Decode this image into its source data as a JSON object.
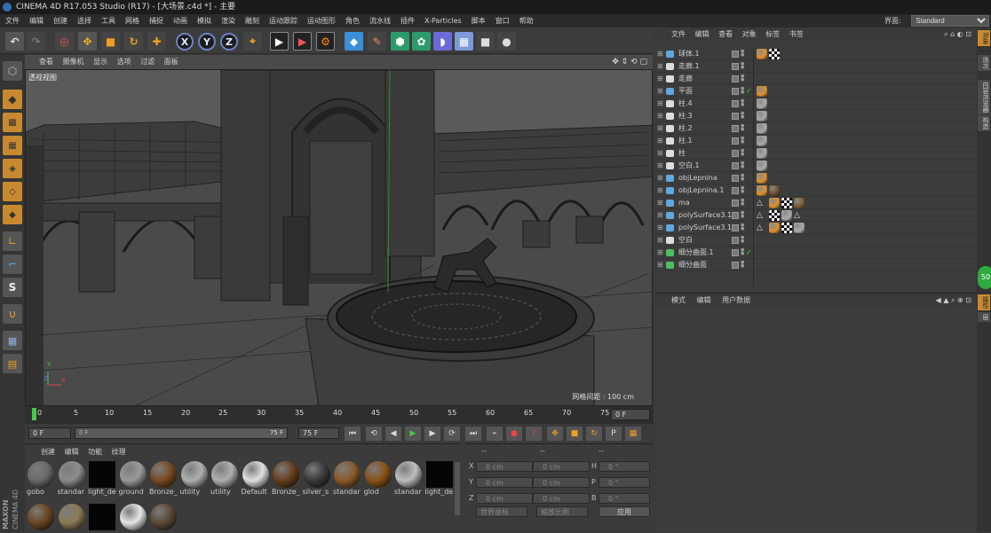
{
  "titlebar": {
    "title": "CINEMA 4D R17.053 Studio (R17) - [大场景.c4d *] - 主要"
  },
  "menubar": {
    "items": [
      "文件",
      "编辑",
      "创建",
      "选择",
      "工具",
      "网格",
      "捕捉",
      "动画",
      "模拟",
      "渲染",
      "雕刻",
      "运动跟踪",
      "运动图形",
      "角色",
      "流水线",
      "插件",
      "X-Particles",
      "脚本",
      "窗口",
      "帮助"
    ],
    "interface_label": "界面:",
    "interface_value": "Standard"
  },
  "viewport": {
    "menu": [
      "查看",
      "摄像机",
      "显示",
      "选项",
      "过滤",
      "面板"
    ],
    "view_name": "透视视图",
    "grid_label": "网格间距 : 100 cm",
    "axis_x": "X",
    "axis_y": "Y",
    "axis_z": "Z"
  },
  "timeline": {
    "ticks": [
      "0",
      "5",
      "10",
      "15",
      "20",
      "25",
      "30",
      "35",
      "40",
      "45",
      "50",
      "55",
      "60",
      "65",
      "70",
      "75"
    ],
    "current_frame": "0 F"
  },
  "transport": {
    "start_field": "0 F",
    "range_start": "0 F",
    "range_end": "75 F",
    "end_field": "75 F"
  },
  "materials": {
    "menu": [
      "创建",
      "编辑",
      "功能",
      "纹理"
    ],
    "items": [
      {
        "label": "gobo",
        "color": "#6a6a6a"
      },
      {
        "label": "standar",
        "color": "#8c8c8c"
      },
      {
        "label": "light_de",
        "color": "#050505"
      },
      {
        "label": "ground",
        "color": "#9a9a9a"
      },
      {
        "label": "Bronze_",
        "color": "#7a4a22"
      },
      {
        "label": "utility",
        "color": "#b0b0b0"
      },
      {
        "label": "utility",
        "color": "#b0b0b0"
      },
      {
        "label": "Default",
        "color": "#e0e0e0"
      },
      {
        "label": "Bronze_",
        "color": "#6a3f1c"
      },
      {
        "label": "silver_s",
        "color": "#3a3a3a"
      },
      {
        "label": "standar",
        "color": "#8a5a2a"
      },
      {
        "label": "glod",
        "color": "#8a5218"
      },
      {
        "label": "standar",
        "color": "#bdbdbd"
      },
      {
        "label": "light_de",
        "color": "#050505"
      }
    ],
    "row2": [
      {
        "color": "#6a4520"
      },
      {
        "color": "#8a7a55"
      },
      {
        "color": "#050505"
      },
      {
        "color": "#e6e6e6"
      },
      {
        "color": "#5a4a38"
      }
    ]
  },
  "coords": {
    "headers": [
      "--",
      "--",
      "--"
    ],
    "rows": [
      {
        "a": "X",
        "av": "0 cm",
        "b": "X",
        "bv": "0 cm",
        "c": "H",
        "cv": "0 °"
      },
      {
        "a": "Y",
        "av": "0 cm",
        "b": "Y",
        "bv": "0 cm",
        "c": "P",
        "cv": "0 °"
      },
      {
        "a": "Z",
        "av": "0 cm",
        "b": "Z",
        "bv": "0 cm",
        "c": "B",
        "cv": "0 °"
      }
    ],
    "space": "世界坐标",
    "scale": "缩放比例",
    "apply": "应用"
  },
  "objects": {
    "menu": [
      "文件",
      "编辑",
      "查看",
      "对象",
      "标签",
      "书签"
    ],
    "rows": [
      {
        "name": "球体.1",
        "icon": "#5fa8e0",
        "ok": false,
        "tags": [
          "#e0902a",
          "chk"
        ]
      },
      {
        "name": "走廊.1",
        "icon": "#ddd",
        "ok": false,
        "tags": []
      },
      {
        "name": "走廊",
        "icon": "#ddd",
        "ok": false,
        "tags": []
      },
      {
        "name": "平面",
        "icon": "#5fa8e0",
        "ok": true,
        "tags": [
          "#e0902a"
        ]
      },
      {
        "name": "柱.4",
        "icon": "#ddd",
        "ok": false,
        "tags": [
          "#aaa"
        ]
      },
      {
        "name": "柱.3",
        "icon": "#ddd",
        "ok": false,
        "tags": [
          "#aaa"
        ]
      },
      {
        "name": "柱.2",
        "icon": "#ddd",
        "ok": false,
        "tags": [
          "#aaa"
        ]
      },
      {
        "name": "柱.1",
        "icon": "#ddd",
        "ok": false,
        "tags": [
          "#aaa"
        ]
      },
      {
        "name": "柱",
        "icon": "#ddd",
        "ok": false,
        "tags": [
          "#aaa"
        ]
      },
      {
        "name": "空白.1",
        "icon": "#ddd",
        "ok": false,
        "tags": [
          "#aaa"
        ]
      },
      {
        "name": "objLepnina",
        "icon": "#5fa8e0",
        "ok": false,
        "tags": [
          "#e0902a"
        ]
      },
      {
        "name": "objLepnina.1",
        "icon": "#5fa8e0",
        "ok": false,
        "tags": [
          "#e0902a",
          "#6a4a2a"
        ]
      },
      {
        "name": "ma",
        "icon": "#5fa8e0",
        "ok": false,
        "tags": [
          "tri",
          "#e0902a",
          "chk",
          "#7a5a35"
        ]
      },
      {
        "name": "polySurface3.1",
        "icon": "#5fa8e0",
        "ok": false,
        "tags": [
          "tri",
          "chk",
          "#aaa",
          "tri"
        ]
      },
      {
        "name": "polySurface3.1",
        "icon": "#5fa8e0",
        "ok": false,
        "tags": [
          "tri",
          "#e0902a",
          "chk",
          "#aaa"
        ]
      },
      {
        "name": "空白",
        "icon": "#ddd",
        "ok": false,
        "tags": []
      },
      {
        "name": "细分曲面.1",
        "icon": "#4cc060",
        "ok": true,
        "tags": []
      },
      {
        "name": "细分曲面",
        "icon": "#4cc060",
        "ok": false,
        "tags": []
      }
    ]
  },
  "attributes": {
    "menu": [
      "模式",
      "编辑",
      "用户数据"
    ]
  },
  "right_tabs": [
    "对象",
    "场次",
    "内容浏览器",
    "构造"
  ],
  "right_tabs2": [
    "属性",
    "层"
  ],
  "badge": "50",
  "maxon_top": "MAXON",
  "maxon_bottom": "CINEMA 4D"
}
